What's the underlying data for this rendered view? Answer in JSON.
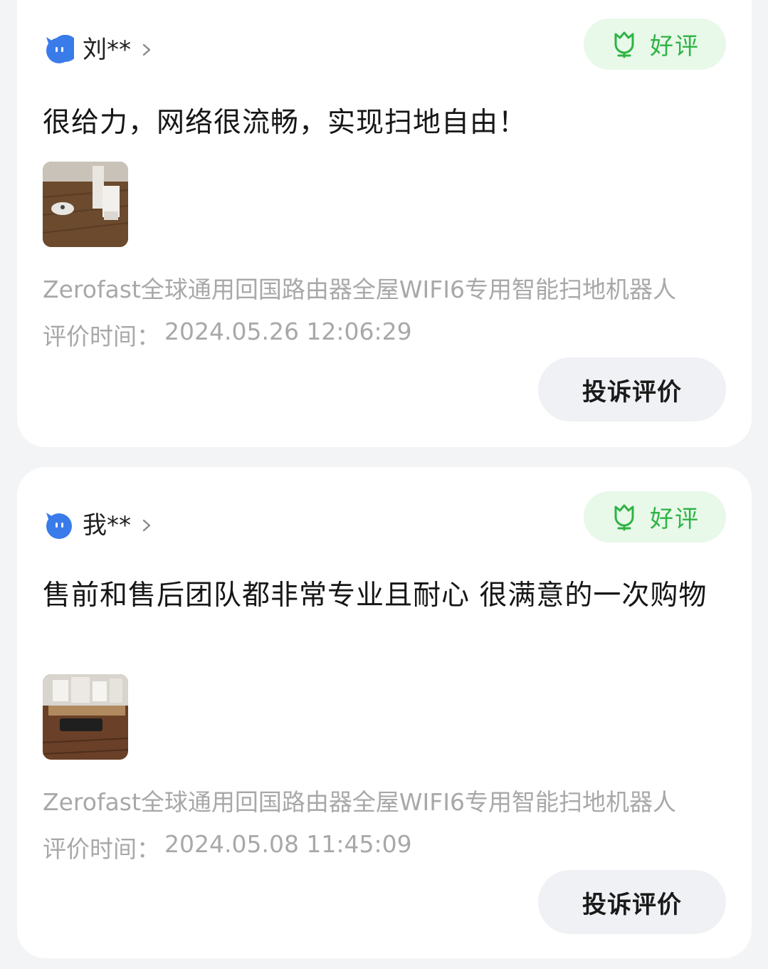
{
  "reviews": [
    {
      "user_name": "刘**",
      "rating_label": "好评",
      "text": "很给力，网络很流畅，实现扫地自由！",
      "product": "Zerofast全球通用回国路由器全屋WIFI6专用智能扫地机器人",
      "time_label": "评价时间：",
      "time_value": "2024.05.26 12:06:29",
      "complain_label": "投诉评价"
    },
    {
      "user_name": "我**",
      "rating_label": "好评",
      "text": "售前和售后团队都非常专业且耐心 很满意的一次购物",
      "product": "Zerofast全球通用回国路由器全屋WIFI6专用智能扫地机器人",
      "time_label": "评价时间：",
      "time_value": "2024.05.08 11:45:09",
      "complain_label": "投诉评价"
    }
  ],
  "colors": {
    "accent_green": "#2fb344",
    "badge_bg": "#e8f8e9",
    "avatar_blue": "#3a7bea",
    "muted_text": "#a8a8a8"
  },
  "icons": {
    "avatar": "avatar-icon",
    "chevron": "chevron-right-icon",
    "rating": "tulip-icon"
  }
}
